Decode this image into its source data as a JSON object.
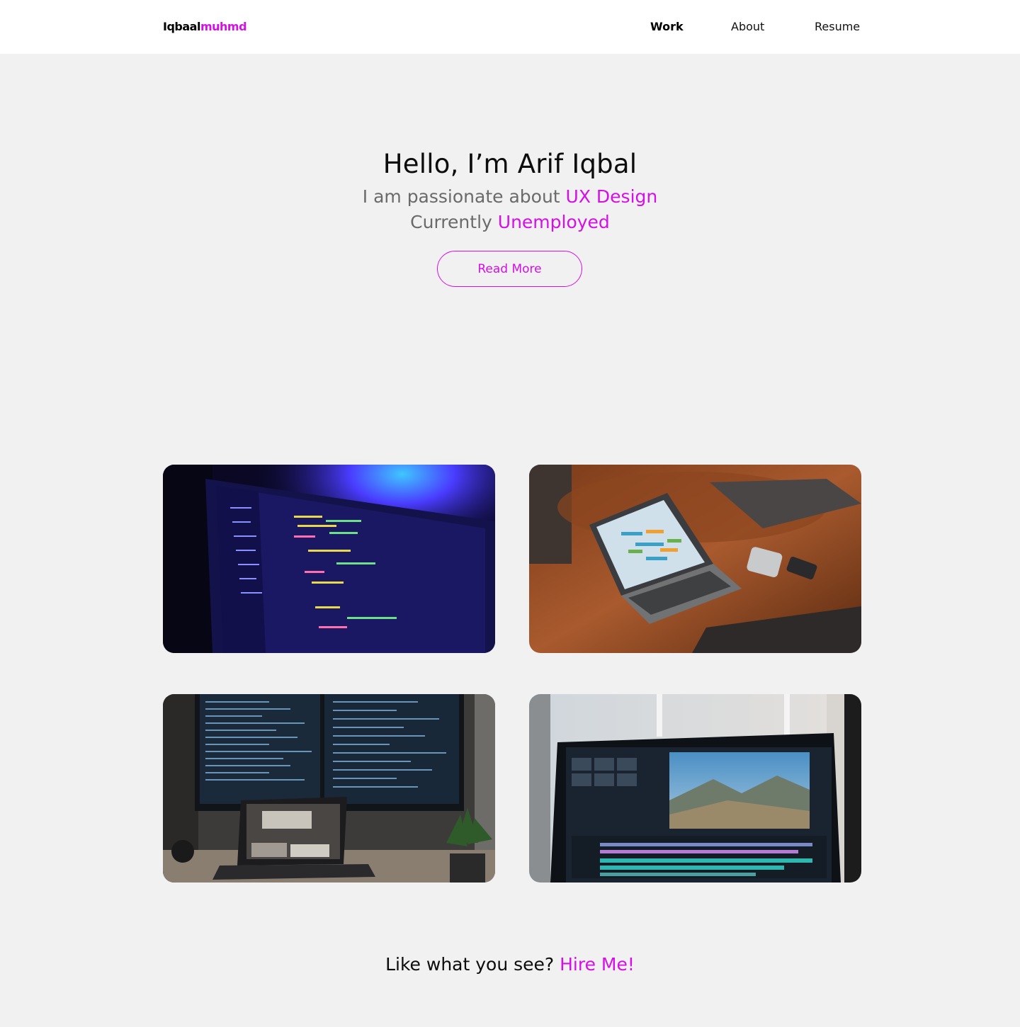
{
  "navbar": {
    "logo_part1": "Iqbaal",
    "logo_part2": "muhmd",
    "links": [
      {
        "label": "Work"
      },
      {
        "label": "About"
      },
      {
        "label": "Resume"
      }
    ]
  },
  "hero": {
    "title": "Hello, I’m Arif Iqbal",
    "line1_prefix": "I am passionate about ",
    "line1_accent": "UX Design",
    "line2_prefix": "Currently ",
    "line2_accent": "Unemployed",
    "button_label": "Read More"
  },
  "work": {
    "cards": [
      {
        "image": "laptop-code-editor-photo"
      },
      {
        "image": "laptop-on-leather-sofa-photo"
      },
      {
        "image": "dual-monitor-coding-desk-photo"
      },
      {
        "image": "video-editing-monitor-photo"
      }
    ]
  },
  "cta": {
    "prefix": "Like what you see? ",
    "link": "Hire Me!"
  },
  "colors": {
    "accent": "#d60fe8",
    "background": "#f1f1f1",
    "navbar": "#ffffff"
  }
}
